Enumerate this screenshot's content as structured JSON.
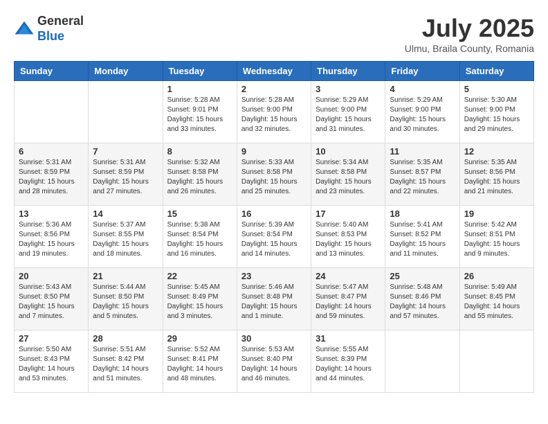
{
  "header": {
    "logo_general": "General",
    "logo_blue": "Blue",
    "month_year": "July 2025",
    "location": "Ulmu, Braila County, Romania"
  },
  "weekdays": [
    "Sunday",
    "Monday",
    "Tuesday",
    "Wednesday",
    "Thursday",
    "Friday",
    "Saturday"
  ],
  "weeks": [
    [
      {
        "day": "",
        "info": ""
      },
      {
        "day": "",
        "info": ""
      },
      {
        "day": "1",
        "info": "Sunrise: 5:28 AM\nSunset: 9:01 PM\nDaylight: 15 hours and 33 minutes."
      },
      {
        "day": "2",
        "info": "Sunrise: 5:28 AM\nSunset: 9:00 PM\nDaylight: 15 hours and 32 minutes."
      },
      {
        "day": "3",
        "info": "Sunrise: 5:29 AM\nSunset: 9:00 PM\nDaylight: 15 hours and 31 minutes."
      },
      {
        "day": "4",
        "info": "Sunrise: 5:29 AM\nSunset: 9:00 PM\nDaylight: 15 hours and 30 minutes."
      },
      {
        "day": "5",
        "info": "Sunrise: 5:30 AM\nSunset: 9:00 PM\nDaylight: 15 hours and 29 minutes."
      }
    ],
    [
      {
        "day": "6",
        "info": "Sunrise: 5:31 AM\nSunset: 8:59 PM\nDaylight: 15 hours and 28 minutes."
      },
      {
        "day": "7",
        "info": "Sunrise: 5:31 AM\nSunset: 8:59 PM\nDaylight: 15 hours and 27 minutes."
      },
      {
        "day": "8",
        "info": "Sunrise: 5:32 AM\nSunset: 8:58 PM\nDaylight: 15 hours and 26 minutes."
      },
      {
        "day": "9",
        "info": "Sunrise: 5:33 AM\nSunset: 8:58 PM\nDaylight: 15 hours and 25 minutes."
      },
      {
        "day": "10",
        "info": "Sunrise: 5:34 AM\nSunset: 8:58 PM\nDaylight: 15 hours and 23 minutes."
      },
      {
        "day": "11",
        "info": "Sunrise: 5:35 AM\nSunset: 8:57 PM\nDaylight: 15 hours and 22 minutes."
      },
      {
        "day": "12",
        "info": "Sunrise: 5:35 AM\nSunset: 8:56 PM\nDaylight: 15 hours and 21 minutes."
      }
    ],
    [
      {
        "day": "13",
        "info": "Sunrise: 5:36 AM\nSunset: 8:56 PM\nDaylight: 15 hours and 19 minutes."
      },
      {
        "day": "14",
        "info": "Sunrise: 5:37 AM\nSunset: 8:55 PM\nDaylight: 15 hours and 18 minutes."
      },
      {
        "day": "15",
        "info": "Sunrise: 5:38 AM\nSunset: 8:54 PM\nDaylight: 15 hours and 16 minutes."
      },
      {
        "day": "16",
        "info": "Sunrise: 5:39 AM\nSunset: 8:54 PM\nDaylight: 15 hours and 14 minutes."
      },
      {
        "day": "17",
        "info": "Sunrise: 5:40 AM\nSunset: 8:53 PM\nDaylight: 15 hours and 13 minutes."
      },
      {
        "day": "18",
        "info": "Sunrise: 5:41 AM\nSunset: 8:52 PM\nDaylight: 15 hours and 11 minutes."
      },
      {
        "day": "19",
        "info": "Sunrise: 5:42 AM\nSunset: 8:51 PM\nDaylight: 15 hours and 9 minutes."
      }
    ],
    [
      {
        "day": "20",
        "info": "Sunrise: 5:43 AM\nSunset: 8:50 PM\nDaylight: 15 hours and 7 minutes."
      },
      {
        "day": "21",
        "info": "Sunrise: 5:44 AM\nSunset: 8:50 PM\nDaylight: 15 hours and 5 minutes."
      },
      {
        "day": "22",
        "info": "Sunrise: 5:45 AM\nSunset: 8:49 PM\nDaylight: 15 hours and 3 minutes."
      },
      {
        "day": "23",
        "info": "Sunrise: 5:46 AM\nSunset: 8:48 PM\nDaylight: 15 hours and 1 minute."
      },
      {
        "day": "24",
        "info": "Sunrise: 5:47 AM\nSunset: 8:47 PM\nDaylight: 14 hours and 59 minutes."
      },
      {
        "day": "25",
        "info": "Sunrise: 5:48 AM\nSunset: 8:46 PM\nDaylight: 14 hours and 57 minutes."
      },
      {
        "day": "26",
        "info": "Sunrise: 5:49 AM\nSunset: 8:45 PM\nDaylight: 14 hours and 55 minutes."
      }
    ],
    [
      {
        "day": "27",
        "info": "Sunrise: 5:50 AM\nSunset: 8:43 PM\nDaylight: 14 hours and 53 minutes."
      },
      {
        "day": "28",
        "info": "Sunrise: 5:51 AM\nSunset: 8:42 PM\nDaylight: 14 hours and 51 minutes."
      },
      {
        "day": "29",
        "info": "Sunrise: 5:52 AM\nSunset: 8:41 PM\nDaylight: 14 hours and 48 minutes."
      },
      {
        "day": "30",
        "info": "Sunrise: 5:53 AM\nSunset: 8:40 PM\nDaylight: 14 hours and 46 minutes."
      },
      {
        "day": "31",
        "info": "Sunrise: 5:55 AM\nSunset: 8:39 PM\nDaylight: 14 hours and 44 minutes."
      },
      {
        "day": "",
        "info": ""
      },
      {
        "day": "",
        "info": ""
      }
    ]
  ]
}
